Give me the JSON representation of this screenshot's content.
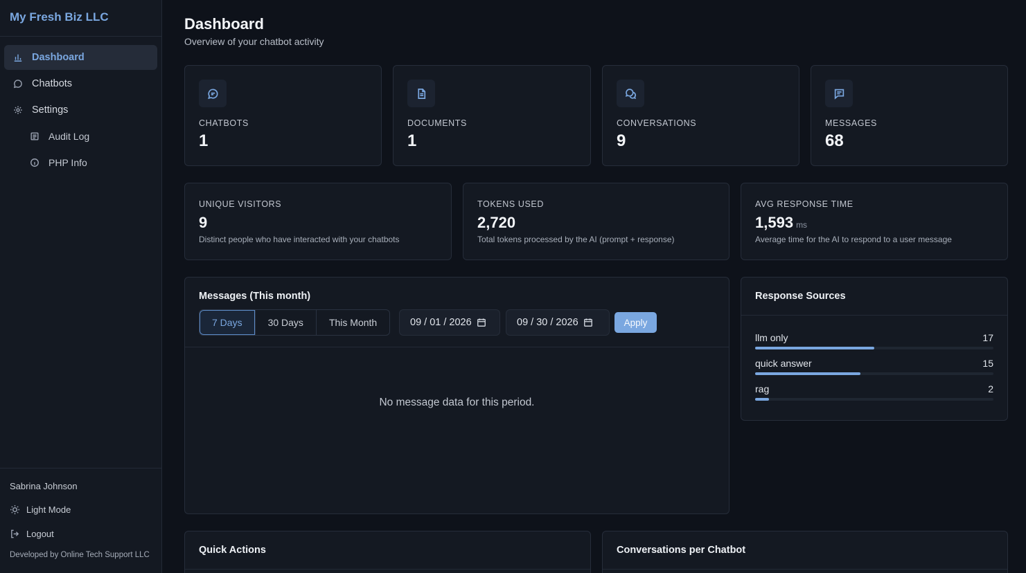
{
  "brand": "My Fresh Biz LLC",
  "nav": [
    {
      "label": "Dashboard",
      "icon": "bar-chart-icon",
      "active": true
    },
    {
      "label": "Chatbots",
      "icon": "message-circle-icon"
    },
    {
      "label": "Settings",
      "icon": "gear-icon"
    },
    {
      "label": "Audit Log",
      "icon": "document-list-icon",
      "sub": true
    },
    {
      "label": "PHP Info",
      "icon": "info-icon",
      "sub": true
    }
  ],
  "footer": {
    "user": "Sabrina Johnson",
    "light_mode": "Light Mode",
    "logout": "Logout",
    "credit": "Developed by Online Tech Support LLC"
  },
  "header": {
    "title": "Dashboard",
    "subtitle": "Overview of your chatbot activity"
  },
  "stats": [
    {
      "label": "CHATBOTS",
      "value": "1",
      "icon": "message-circle-icon"
    },
    {
      "label": "DOCUMENTS",
      "value": "1",
      "icon": "document-icon"
    },
    {
      "label": "CONVERSATIONS",
      "value": "9",
      "icon": "chat-bubbles-icon"
    },
    {
      "label": "MESSAGES",
      "value": "68",
      "icon": "message-square-icon"
    }
  ],
  "metrics": [
    {
      "label": "UNIQUE VISITORS",
      "value": "9",
      "unit": "",
      "desc": "Distinct people who have interacted with your chatbots"
    },
    {
      "label": "TOKENS USED",
      "value": "2,720",
      "unit": "",
      "desc": "Total tokens processed by the AI (prompt + response)"
    },
    {
      "label": "AVG RESPONSE TIME",
      "value": "1,593",
      "unit": "ms",
      "desc": "Average time for the AI to respond to a user message"
    }
  ],
  "messages_card": {
    "title": "Messages (This month)",
    "ranges": [
      "7 Days",
      "30 Days",
      "This Month"
    ],
    "active_range": "7 Days",
    "date_from": "09 / 01 / 2026",
    "date_to": "09 / 30 / 2026",
    "apply": "Apply",
    "empty": "No message data for this period."
  },
  "sources_card": {
    "title": "Response Sources",
    "items": [
      {
        "label": "llm only",
        "count": 17,
        "fraction": 0.5
      },
      {
        "label": "quick answer",
        "count": 15,
        "fraction": 0.441
      },
      {
        "label": "rag",
        "count": 2,
        "fraction": 0.059
      }
    ]
  },
  "quick_actions": {
    "title": "Quick Actions"
  },
  "conv_per_chatbot": {
    "title": "Conversations per Chatbot"
  },
  "colors": {
    "accent": "#7aa7e0",
    "background": "#0e121a",
    "card": "#141922"
  }
}
